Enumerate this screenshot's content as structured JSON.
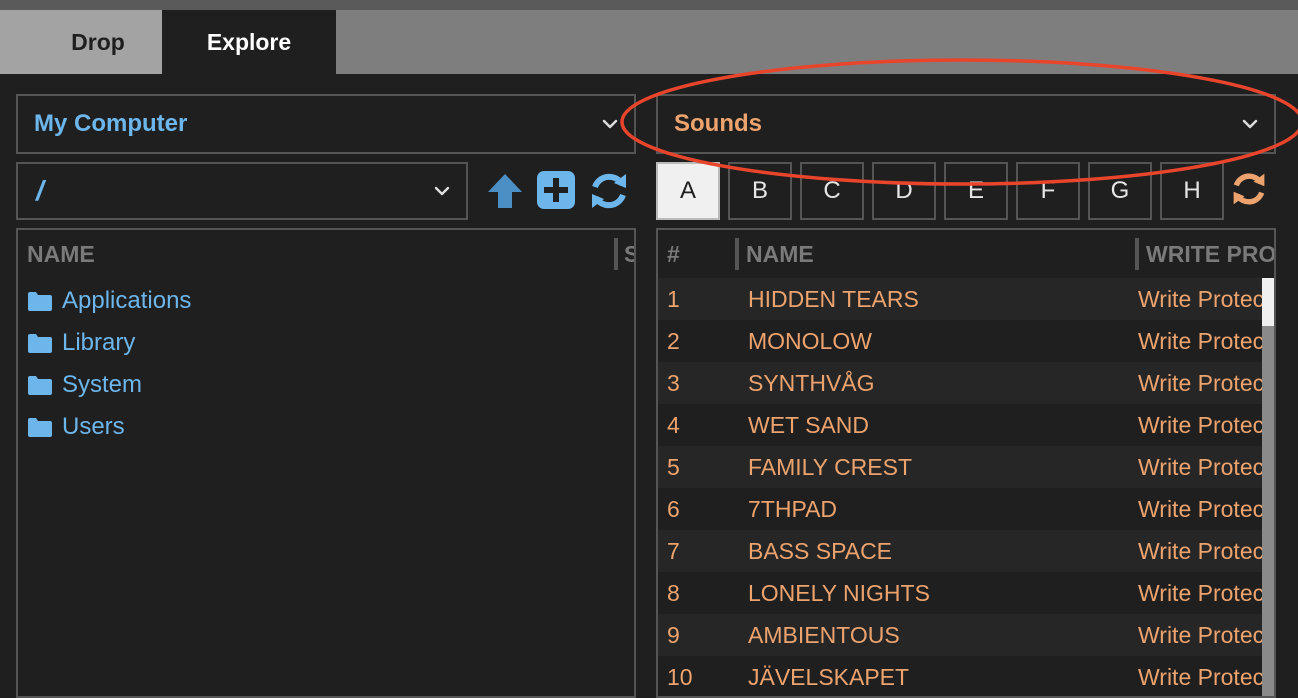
{
  "tabs": {
    "drop": "Drop",
    "explore": "Explore"
  },
  "left": {
    "location_select": "My Computer",
    "path_select": "/",
    "column_name": "NAME",
    "column_size": "S",
    "folders": [
      "Applications",
      "Library",
      "System",
      "Users"
    ]
  },
  "right": {
    "bank_select": "Sounds",
    "slots": [
      "A",
      "B",
      "C",
      "D",
      "E",
      "F",
      "G",
      "H"
    ],
    "active_slot": "A",
    "column_num": "#",
    "column_name": "NAME",
    "column_write": "WRITE PRO",
    "patches": [
      {
        "num": "1",
        "name": "HIDDEN TEARS",
        "status": "Write Protected"
      },
      {
        "num": "2",
        "name": "MONOLOW",
        "status": "Write Protected"
      },
      {
        "num": "3",
        "name": "SYNTHVÅG",
        "status": "Write Protected"
      },
      {
        "num": "4",
        "name": "WET SAND",
        "status": "Write Protected"
      },
      {
        "num": "5",
        "name": "FAMILY CREST",
        "status": "Write Protected"
      },
      {
        "num": "6",
        "name": "7THPAD",
        "status": "Write Protected"
      },
      {
        "num": "7",
        "name": "BASS SPACE",
        "status": "Write Protected"
      },
      {
        "num": "8",
        "name": "LONELY NIGHTS",
        "status": "Write Protected"
      },
      {
        "num": "9",
        "name": "AMBIENTOUS",
        "status": "Write Protected"
      },
      {
        "num": "10",
        "name": "JÄVELSKAPET",
        "status": "Write Protected"
      }
    ]
  },
  "icons": {
    "up": "arrow-up-icon",
    "add": "plus-square-icon",
    "refresh": "refresh-icon",
    "folder": "folder-icon",
    "chevron": "chevron-down-icon"
  },
  "colors": {
    "accent_blue": "#6cb6ec",
    "accent_orange": "#eda36d",
    "highlight_red": "#e8452c"
  }
}
